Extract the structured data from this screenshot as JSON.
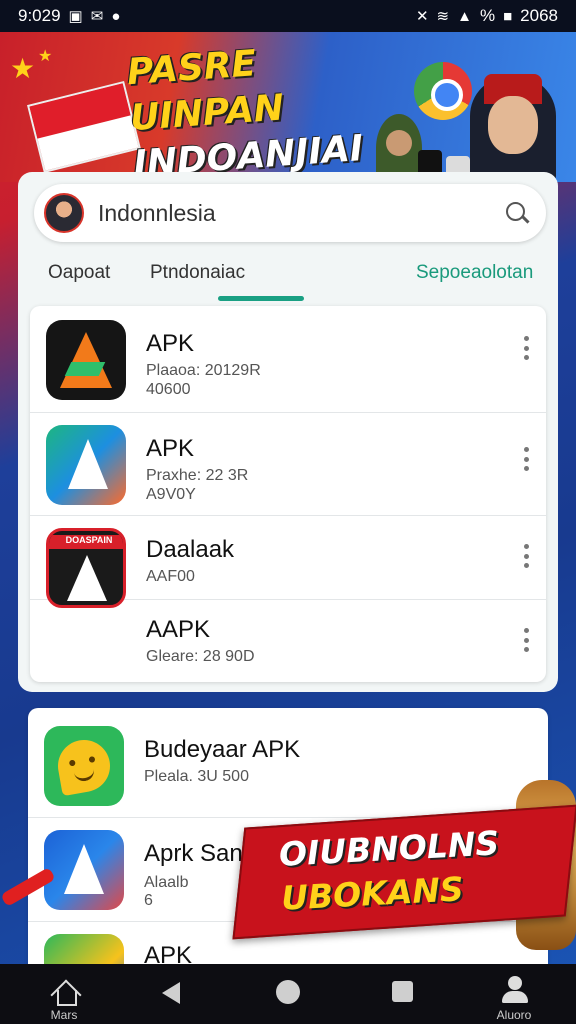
{
  "status_bar": {
    "time": "9:029",
    "battery_text": "%",
    "right_time": "2068"
  },
  "banner": {
    "title_line1": "PASRE UINPAN",
    "title_line2": "INDOANJIAI"
  },
  "search": {
    "value": "Indonnlesia"
  },
  "tabs": [
    {
      "label": "Oapoat"
    },
    {
      "label": "Ptndonaiac"
    },
    {
      "label": "Sepoeaolotan"
    }
  ],
  "apps": [
    {
      "name": "APK",
      "meta_line1": "Plaaoa: 20129R",
      "meta_line2": "40600"
    },
    {
      "name": "APK",
      "meta_line1": "Praxhe: 22 3R",
      "meta_line2": "A9V0Y"
    },
    {
      "name": "Daalaak",
      "meta_line1": "AAF00",
      "icon_text": "DOASPAIN"
    },
    {
      "name": "AAPK",
      "meta_line1": "Gleare: 28 90D"
    }
  ],
  "apps_second": [
    {
      "name": "Budeyaar APK",
      "meta_line1": "Pleala. 3U 500"
    },
    {
      "name": "Aprk  Sanon",
      "meta_line1": "Alaalb",
      "meta_line2": "6"
    },
    {
      "name": "APK"
    }
  ],
  "promo": {
    "line1": "OIUBNOLNS",
    "line2": "UBOKANS"
  },
  "nav": {
    "home_label": "Mars",
    "profile_label": "Aluoro"
  },
  "colors": {
    "accent": "#1aa083",
    "flag_red": "#e01e2a",
    "promo_red": "#c8121c",
    "banner_yellow": "#ffd21a"
  }
}
